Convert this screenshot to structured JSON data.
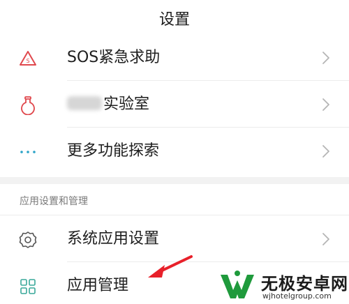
{
  "header": {
    "title": "设置"
  },
  "rows": {
    "sos": {
      "label": "SOS紧急求助",
      "icon": "sos-warning-icon"
    },
    "lab": {
      "label": "实验室",
      "icon": "flask-icon",
      "blurred_prefix": "redacted brand name"
    },
    "more": {
      "label": "更多功能探索",
      "icon": "more-dots-icon"
    },
    "sys_apps": {
      "label": "系统应用设置",
      "icon": "gear-icon"
    },
    "app_mgmt": {
      "label": "应用管理",
      "icon": "grid-apps-icon"
    }
  },
  "section": {
    "title": "应用设置和管理"
  },
  "watermark": {
    "name": "无极安卓网",
    "url": "wjhotelgroup.com"
  },
  "colors": {
    "sos_icon": "#e0484d",
    "lab_icon": "#e0484d",
    "more_icon": "#2aa3c7",
    "sys_icon": "#555555",
    "grid_icon": "#39a89a",
    "arrow": "#e8202a",
    "watermark_green": "#1f9a3c"
  }
}
